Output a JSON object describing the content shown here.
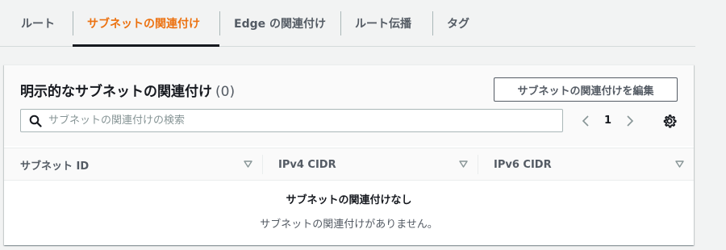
{
  "tabs": [
    {
      "label": "ルート",
      "active": false
    },
    {
      "label": "サブネットの関連付け",
      "active": true
    },
    {
      "label": "Edge の関連付け",
      "active": false
    },
    {
      "label": "ルート伝播",
      "active": false
    },
    {
      "label": "タグ",
      "active": false
    }
  ],
  "panel": {
    "title": "明示的なサブネットの関連付け",
    "count": "(0)",
    "edit_button_label": "サブネットの関連付けを編集"
  },
  "search": {
    "placeholder": "サブネットの関連付けの検索",
    "value": ""
  },
  "pagination": {
    "current_page": "1"
  },
  "table": {
    "columns": [
      {
        "label": "サブネット ID"
      },
      {
        "label": "IPv4 CIDR"
      },
      {
        "label": "IPv6 CIDR"
      }
    ],
    "empty_title": "サブネットの関連付けなし",
    "empty_description": "サブネットの関連付けがありません。"
  },
  "colors": {
    "accent": "#ec7211",
    "text": "#16191f",
    "muted": "#545b64"
  },
  "icons": {
    "search": "search-icon",
    "prev": "chevron-left-icon",
    "next": "chevron-right-icon",
    "settings": "gear-icon",
    "sort": "caret-down-icon"
  }
}
